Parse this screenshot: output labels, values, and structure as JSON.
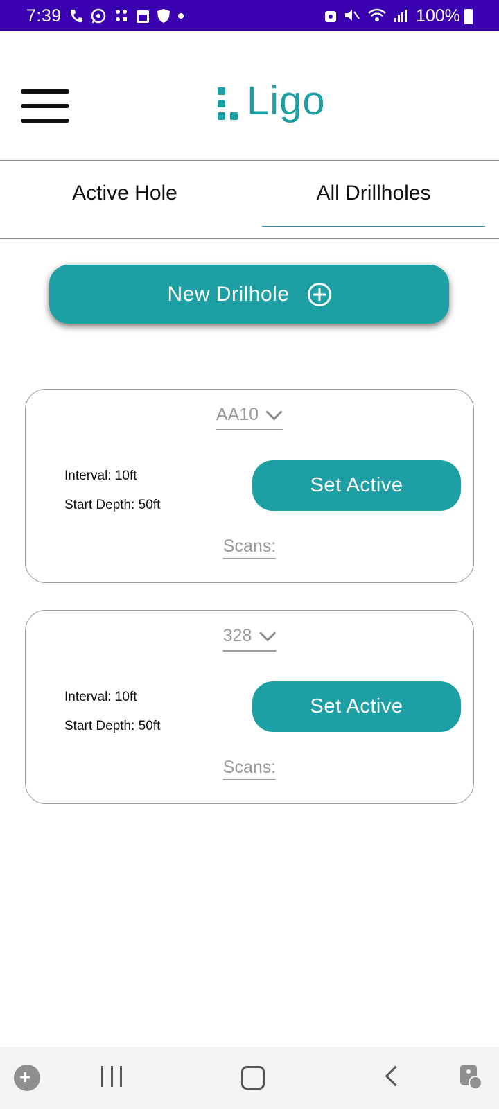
{
  "status_bar": {
    "time": "7:39",
    "battery": "100%",
    "background": "#3a00b0",
    "left_icons": [
      "phone-icon",
      "whatsapp-icon",
      "app-icon",
      "calendar-icon",
      "shield-icon",
      "dot-icon"
    ],
    "right_icons": [
      "vpn-icon",
      "mute-icon",
      "wifi-icon",
      "signal-icon",
      "battery-icon"
    ]
  },
  "header": {
    "logo_text": "Ligo",
    "brand_color": "#1e9fa3"
  },
  "tabs": [
    {
      "label": "Active Hole",
      "selected": false
    },
    {
      "label": "All Drillholes",
      "selected": true
    }
  ],
  "new_button": {
    "label": "New Drilhole"
  },
  "drillholes": [
    {
      "name": "AA10",
      "interval": "Interval: 10ft",
      "start_depth": "Start Depth: 50ft",
      "action": "Set Active",
      "scans": "Scans:"
    },
    {
      "name": "328",
      "interval": "Interval: 10ft",
      "start_depth": "Start Depth: 50ft",
      "action": "Set Active",
      "scans": "Scans:"
    }
  ],
  "nav_bar": {
    "buttons": [
      "game-tools-icon",
      "recent-apps-icon",
      "home-icon",
      "back-icon",
      "accessibility-icon"
    ]
  }
}
